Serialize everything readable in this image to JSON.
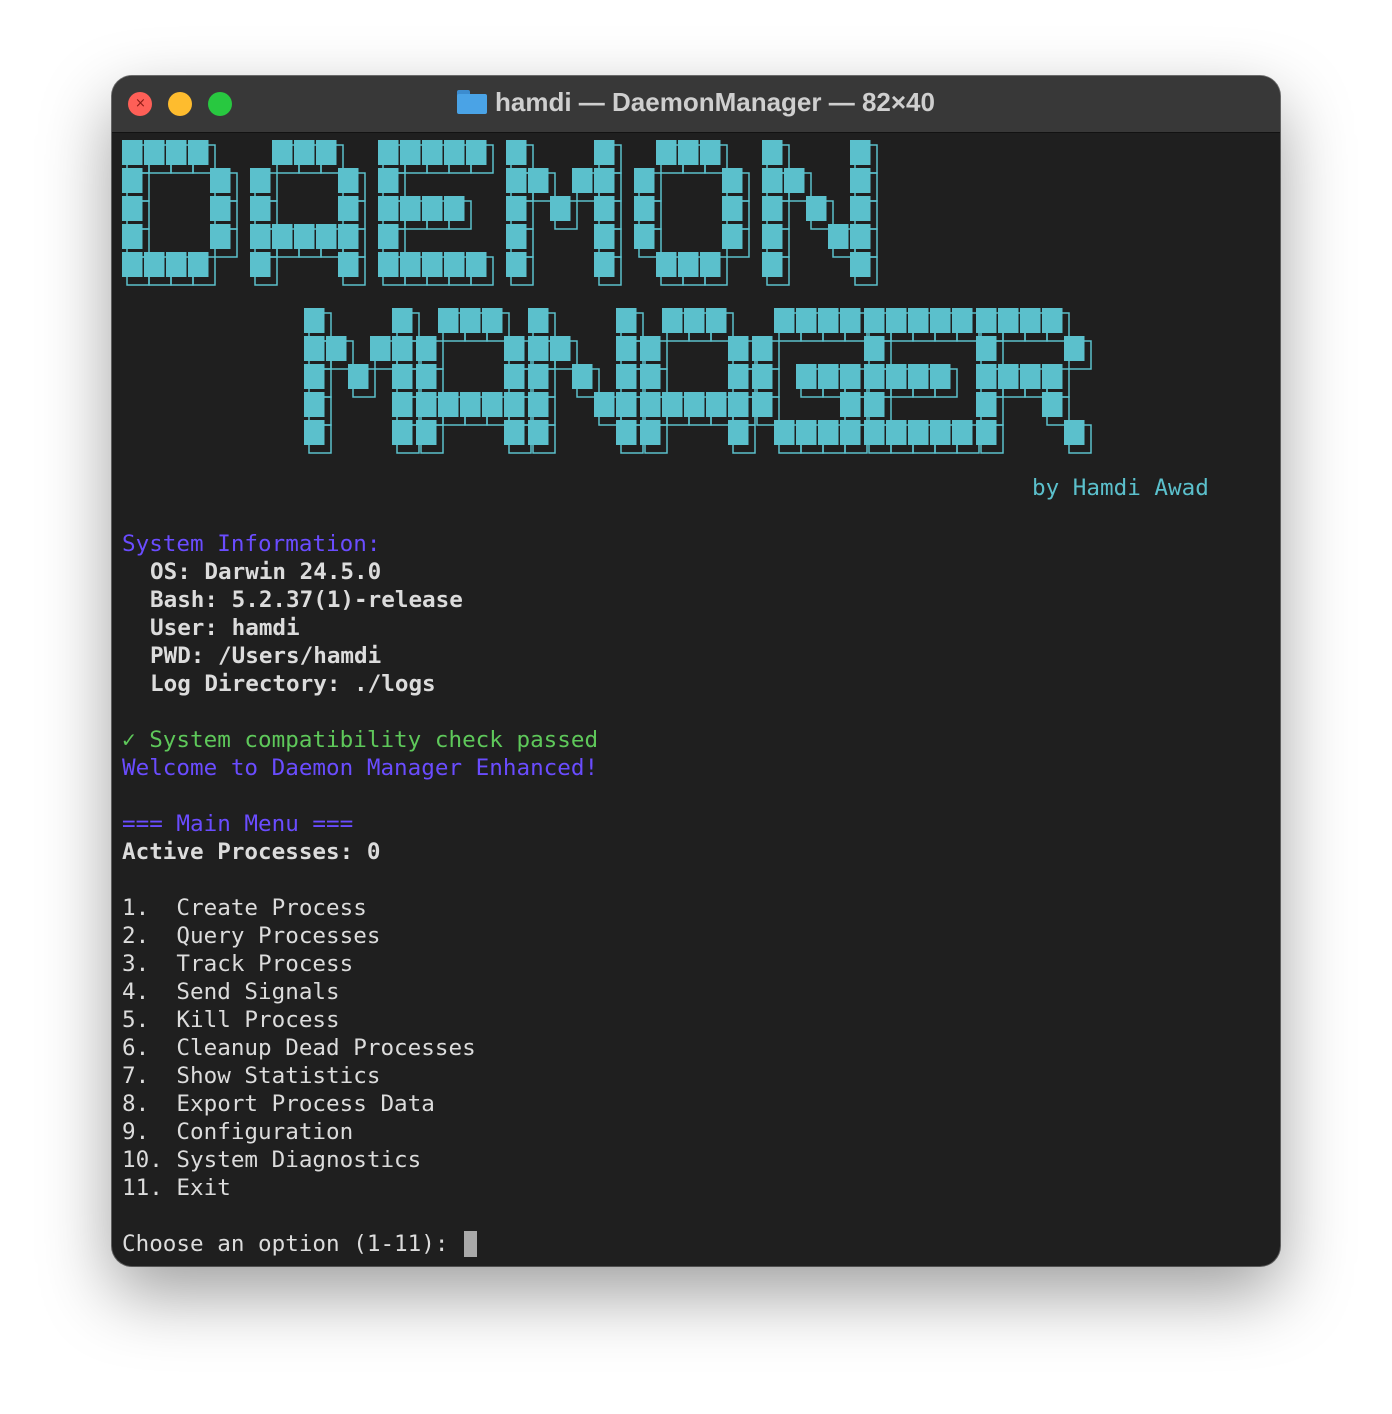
{
  "window": {
    "title": "hamdi — DaemonManager — 82×40",
    "title_icon": "folder-icon",
    "controls": [
      "close-icon",
      "minimize-icon",
      "zoom-icon"
    ]
  },
  "banner": {
    "text_top": "DAEMON",
    "text_bottom": "MANAGER",
    "byline": "by Hamdi Awad",
    "color": "#5bc0cc"
  },
  "system_info": {
    "heading": "System Information:",
    "lines": [
      "OS: Darwin 24.5.0",
      "Bash: 5.2.37(1)-release",
      "User: hamdi",
      "PWD: /Users/hamdi",
      "Log Directory: ./logs"
    ]
  },
  "status": {
    "check_icon": "check-icon",
    "check": "✓ System compatibility check passed",
    "welcome": "Welcome to Daemon Manager Enhanced!"
  },
  "menu": {
    "heading": "=== Main Menu ===",
    "active_label": "Active Processes: 0",
    "items": [
      "1.  Create Process",
      "2.  Query Processes",
      "3.  Track Process",
      "4.  Send Signals",
      "5.  Kill Process",
      "6.  Cleanup Dead Processes",
      "7.  Show Statistics",
      "8.  Export Process Data",
      "9.  Configuration",
      "10. System Diagnostics",
      "11. Exit"
    ]
  },
  "prompt": "Choose an option (1-11): ",
  "colors": {
    "background": "#1f1f1f",
    "titlebar": "#383838",
    "purple": "#6a4cff",
    "green": "#5ec85a",
    "cyan": "#5bc0cc"
  }
}
